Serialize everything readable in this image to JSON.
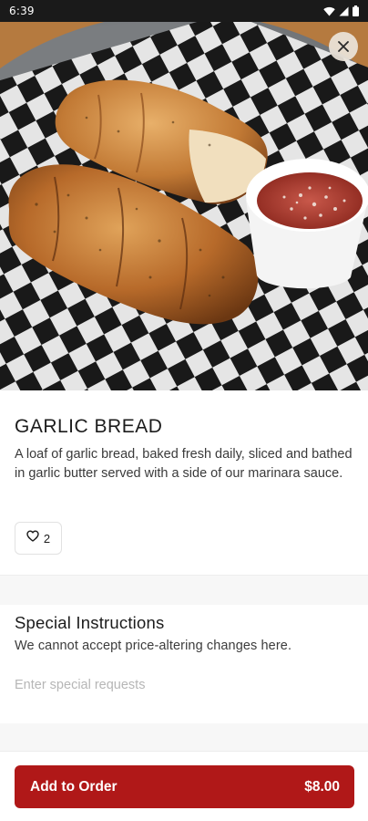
{
  "status_bar": {
    "time": "6:39",
    "icons": [
      "wifi-icon",
      "signal-icon",
      "battery-icon"
    ]
  },
  "hero": {
    "icon": "close-icon"
  },
  "item": {
    "title": "GARLIC BREAD",
    "description": "A loaf of garlic bread, baked fresh daily, sliced and bathed in garlic butter served with a side of our marinara sauce.",
    "likes": "2",
    "like_icon": "heart-icon"
  },
  "special_instructions": {
    "title": "Special Instructions",
    "subtitle": "We cannot accept price-altering changes here.",
    "placeholder": "Enter special requests",
    "value": ""
  },
  "footer": {
    "button_label": "Add to Order",
    "price": "$8.00",
    "accent_color": "#b01818"
  }
}
